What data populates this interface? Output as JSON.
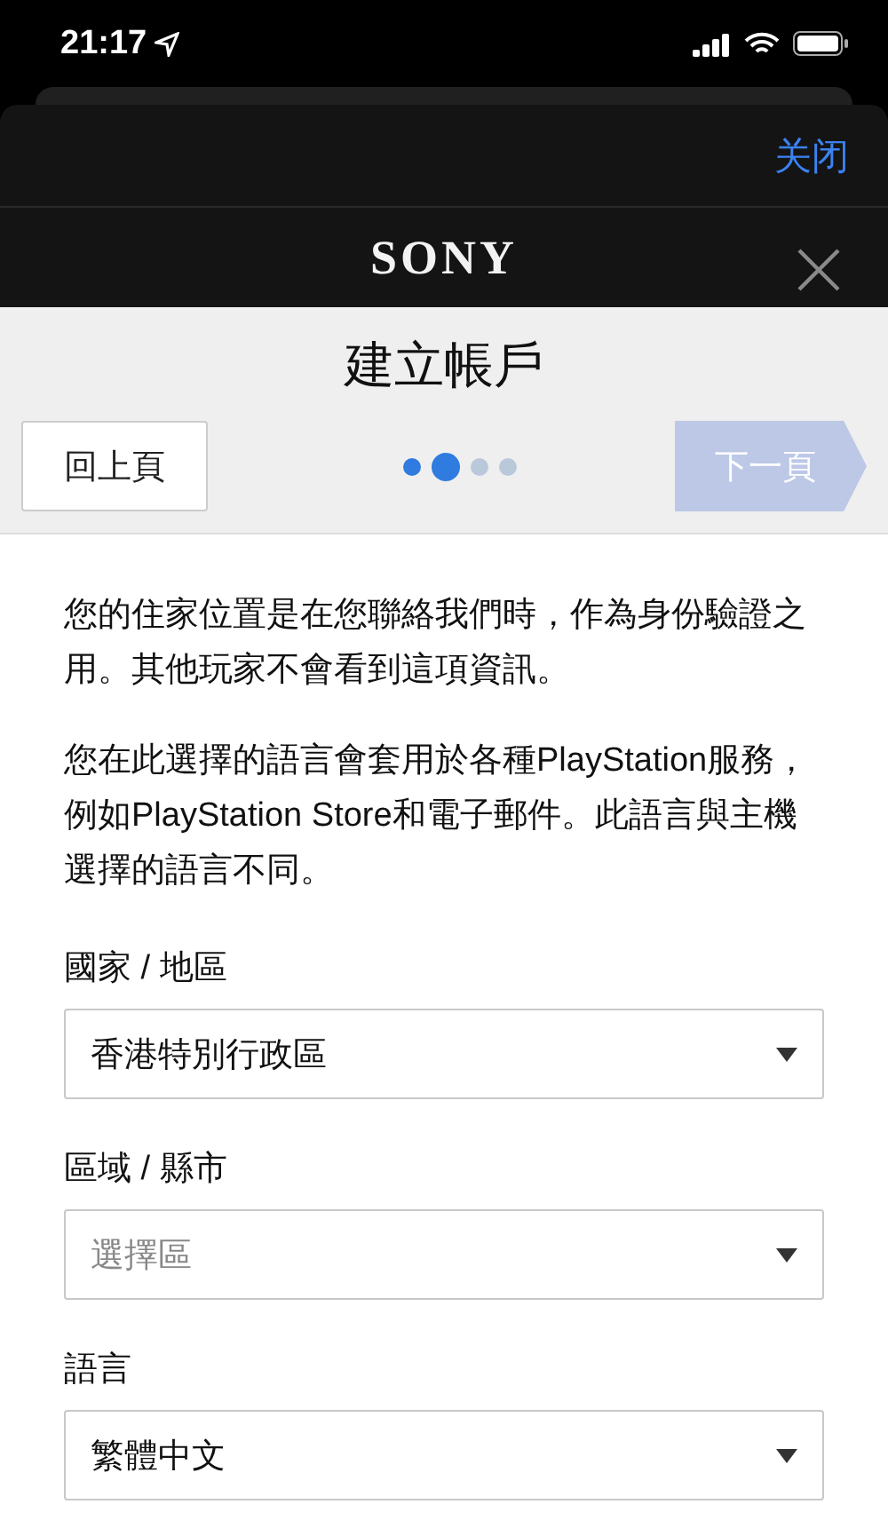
{
  "status_bar": {
    "time": "21:17"
  },
  "sheet": {
    "close_link": "关闭"
  },
  "brand_bar": {
    "logo": "SONY"
  },
  "header": {
    "title": "建立帳戶",
    "back_button": "回上頁",
    "next_button": {
      "label": "下一頁",
      "disabled": true
    },
    "steps": [
      {
        "selected": false,
        "completed": true
      },
      {
        "selected": true,
        "completed": false
      },
      {
        "selected": false,
        "completed": false
      },
      {
        "selected": false,
        "completed": false
      }
    ]
  },
  "paragraphs": [
    "您的住家位置是在您聯絡我們時，作為身份驗證之用。其他玩家不會看到這項資訊。",
    "您在此選擇的語言會套用於各種PlayStation服務，例如PlayStation Store和電子郵件。此語言與主機選擇的語言不同。"
  ],
  "fields": [
    {
      "label": "國家 / 地區",
      "value": "香港特別行政區"
    },
    {
      "label": "區域 / 縣市",
      "placeholder": "選擇區"
    },
    {
      "label": "語言",
      "value": "繁體中文"
    }
  ]
}
